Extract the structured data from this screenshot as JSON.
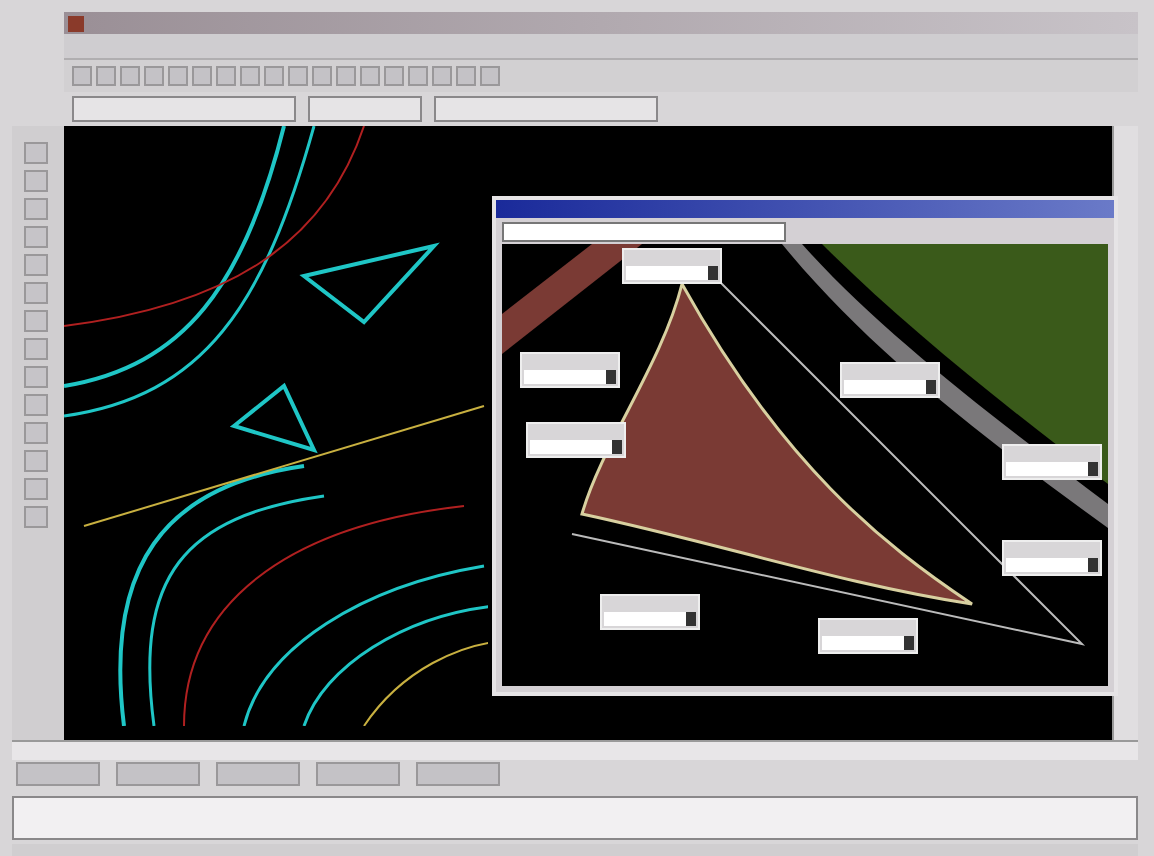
{
  "main_toolbar": [
    {
      "kind": "icon"
    },
    {
      "kind": "icon"
    },
    {
      "kind": "icon"
    },
    {
      "kind": "icon"
    },
    {
      "kind": "icon"
    },
    {
      "kind": "icon"
    },
    {
      "kind": "icon"
    },
    {
      "kind": "icon"
    },
    {
      "kind": "icon"
    },
    {
      "kind": "icon"
    },
    {
      "kind": "icon"
    },
    {
      "kind": "icon"
    },
    {
      "kind": "icon"
    },
    {
      "kind": "icon"
    },
    {
      "kind": "icon"
    },
    {
      "kind": "icon"
    },
    {
      "kind": "icon"
    },
    {
      "kind": "icon"
    }
  ],
  "left_toolbar": [
    {
      "kind": "icon"
    },
    {
      "kind": "icon"
    },
    {
      "kind": "icon"
    },
    {
      "kind": "icon"
    },
    {
      "kind": "icon"
    },
    {
      "kind": "icon"
    },
    {
      "kind": "icon"
    },
    {
      "kind": "icon"
    },
    {
      "kind": "icon"
    },
    {
      "kind": "icon"
    },
    {
      "kind": "icon"
    },
    {
      "kind": "icon"
    },
    {
      "kind": "icon"
    },
    {
      "kind": "icon"
    }
  ],
  "dialog": {
    "callouts": [
      {
        "kind": "dropdown"
      },
      {
        "kind": "dropdown"
      },
      {
        "kind": "dropdown"
      },
      {
        "kind": "dropdown"
      },
      {
        "kind": "dropdown"
      },
      {
        "kind": "dropdown"
      },
      {
        "kind": "dropdown"
      },
      {
        "kind": "dropdown"
      }
    ]
  }
}
